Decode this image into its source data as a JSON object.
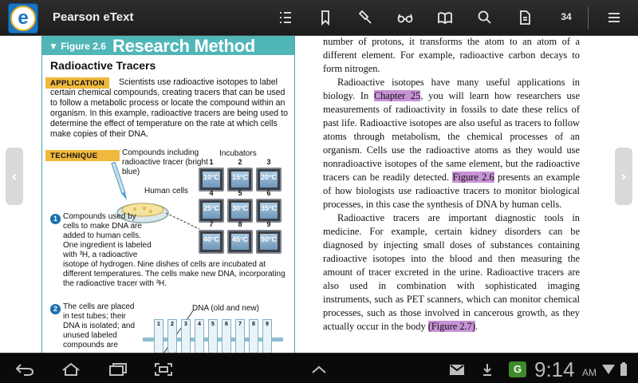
{
  "topbar": {
    "app_title": "Pearson eText",
    "logo_letter": "e",
    "page_number": "34",
    "icons": [
      "contents-list-icon",
      "bookmark-icon",
      "highlighter-icon",
      "glasses-icon",
      "book-icon",
      "search-icon",
      "page-icon",
      "menu-icon"
    ]
  },
  "figure": {
    "label": "▼ Figure 2.6",
    "title": "Research Method",
    "subtitle": "Radioactive Tracers",
    "application_tag": "APPLICATION",
    "application_text": "Scientists use radioactive isotopes to label certain chemical compounds, creating tracers that can be used to follow a metabolic process or locate the compound within an organism. In this example, radioactive tracers are being used to determine the effect of temperature on the rate at which cells make copies of their DNA.",
    "technique_tag": "TECHNIQUE",
    "compounds_label": "Compounds including radioactive tracer (bright blue)",
    "incubators_label": "Incubators",
    "human_cells_label": "Human cells",
    "incubators": [
      {
        "num": "1",
        "temp": "10°C"
      },
      {
        "num": "2",
        "temp": "15°C"
      },
      {
        "num": "3",
        "temp": "20°C"
      },
      {
        "num": "4",
        "temp": "25°C"
      },
      {
        "num": "5",
        "temp": "30°C"
      },
      {
        "num": "6",
        "temp": "35°C"
      },
      {
        "num": "7",
        "temp": "40°C"
      },
      {
        "num": "8",
        "temp": "45°C"
      },
      {
        "num": "9",
        "temp": "50°C"
      }
    ],
    "step1_num": "1",
    "step1_text_a": "Compounds used by cells to make DNA are added to human cells. One ingredient is labeled with ³H, a radioactive",
    "step1_text_b": "isotope of hydrogen. Nine dishes of cells are incubated at different temperatures. The cells make new DNA, incorporating the radioactive tracer with ³H.",
    "step2_num": "2",
    "step2_text": "The cells are placed in test tubes; their DNA is isolated; and unused labeled compounds are",
    "dna_label": "DNA (old and new)",
    "tube_numbers": [
      "1",
      "2",
      "3",
      "4",
      "5",
      "6",
      "7",
      "8",
      "9"
    ]
  },
  "text": {
    "p1": "number of protons, it transforms the atom to an atom of a different element. For example, radioactive carbon decays to form nitrogen.",
    "p2_a": "Radioactive isotopes have many useful applications in biology. In ",
    "p2_link1": "Chapter 25",
    "p2_b": ", you will learn how researchers use measurements of radioactivity in fossils to date these relics of past life. Radioactive isotopes are also useful as tracers to follow atoms through metabolism, the chemical processes of an organism. Cells use the radioactive atoms as they would use nonradioactive isotopes of the same element, but the radioactive tracers can be readily detected. ",
    "p2_link2": "Figure 2.6",
    "p2_c": " presents an example of how biologists use radioactive tracers to monitor biological processes, in this case the synthesis of DNA by human cells.",
    "p3_a": "Radioactive tracers are important diagnostic tools in medicine. For example, certain kidney disorders can be diagnosed by injecting small doses of substances containing radioactive isotopes into the blood and then measuring the amount of tracer excreted in the urine. Radioactive tracers are also used in combination with sophisticated imaging instruments, such as PET scanners, which can monitor chemical processes, such as those involved in cancerous growth, as they actually occur in the body ",
    "p3_link": "(Figure 2.7)",
    "p3_b": "."
  },
  "nav": {
    "prev": "‹",
    "next": "›"
  },
  "statusbar": {
    "time": "9:14",
    "ampm": "AM",
    "app_badge": "G"
  },
  "colors": {
    "teal": "#51b6b8",
    "tag": "#f0b83c",
    "highlight": "#c792d6"
  }
}
